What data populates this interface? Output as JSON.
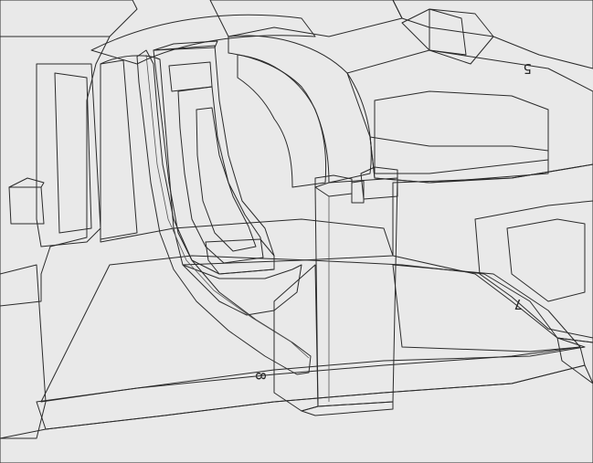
{
  "viewport": {
    "background_color": "#e9e9e9"
  },
  "colors": {
    "housing_light": "#ececec",
    "housing_mid": "#cfcfcf",
    "housing_dark": "#8f8f8f",
    "housing_shadow": "#6d6d6d",
    "part_orange": "#e07a30",
    "part_orange_dark": "#b9571c",
    "part_orange_light": "#f09a55",
    "part_green": "#9fd25a",
    "part_green_dark": "#6ea634",
    "edge": "#2a2a2a"
  },
  "labels": {
    "slot_5": "5",
    "slot_7": "7",
    "slot_8": "8"
  },
  "icons": {
    "model_view": "3d-model-icon"
  }
}
